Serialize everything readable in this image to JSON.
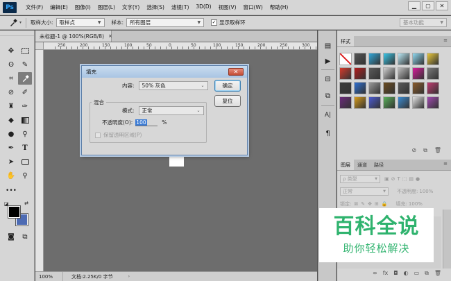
{
  "app": {
    "logo": "Ps"
  },
  "menubar": {
    "items": [
      "文件(F)",
      "编辑(E)",
      "图像(I)",
      "图层(L)",
      "文字(Y)",
      "选择(S)",
      "滤镜(T)",
      "3D(D)",
      "视图(V)",
      "窗口(W)",
      "帮助(H)"
    ]
  },
  "window_controls": {
    "minimize": "▁",
    "restore": "▢",
    "close": "✕"
  },
  "options_bar": {
    "sample_size_label": "取样大小:",
    "sample_size_value": "取样点",
    "sample_label": "样本:",
    "sample_value": "所有图层",
    "show_ring_label": "显示取样环",
    "show_ring_checked": true,
    "workspace": "基本功能"
  },
  "document": {
    "tab_title": "未标题-1 @ 100%(RGB/8)",
    "tab_close": "×",
    "ruler_labels": [
      "250",
      "200",
      "150",
      "100",
      "50",
      "0",
      "50",
      "100",
      "150",
      "200",
      "250",
      "300",
      "350"
    ]
  },
  "status": {
    "zoom": "100%",
    "doc_info": "文档:2.25K/0 字节",
    "arrow": "›"
  },
  "fill_dialog": {
    "title": "填充",
    "close": "✕",
    "content_label": "内容:",
    "content_value": "50% 灰色",
    "ok": "确定",
    "reset": "复位",
    "blending_label": "混合",
    "mode_label": "模式:",
    "mode_value": "正常",
    "opacity_label": "不透明度(O):",
    "opacity_value": "100",
    "opacity_unit": "%",
    "preserve_label": "保留透明区域(P)"
  },
  "styles_panel": {
    "tab": "样式",
    "colors": [
      "#ffffff",
      "#555555",
      "#2fa6d8",
      "#39c6e8",
      "#b9e8f5",
      "#8fd8f0",
      "#e8c73a",
      "#d53a2b",
      "#b31c1c",
      "#5a5a5a",
      "#cfcfcf",
      "#bcbcbc",
      "#d81a9a",
      "#7a7a7a",
      "#3a3a3a",
      "#2e6fd1",
      "#9a9a9a",
      "#6b4c1f",
      "#5a5a5a",
      "#8a5a2a",
      "#c03a70",
      "#6a2a7a",
      "#d69a1a",
      "#4a5ad0",
      "#5ab05a",
      "#3a8ad0",
      "#e0e0e0",
      "#a04ab0"
    ]
  },
  "layers_panel": {
    "tabs": [
      "图层",
      "通道",
      "路径"
    ],
    "kind_label": "ρ 类型",
    "blend_mode": "正常",
    "opacity_label": "不透明度:",
    "opacity_value": "100%",
    "lock_label": "锁定:",
    "fill_label": "填充:",
    "fill_value": "100%"
  },
  "watermark": {
    "title": "百科全说",
    "subtitle": "助你轻松解决"
  }
}
